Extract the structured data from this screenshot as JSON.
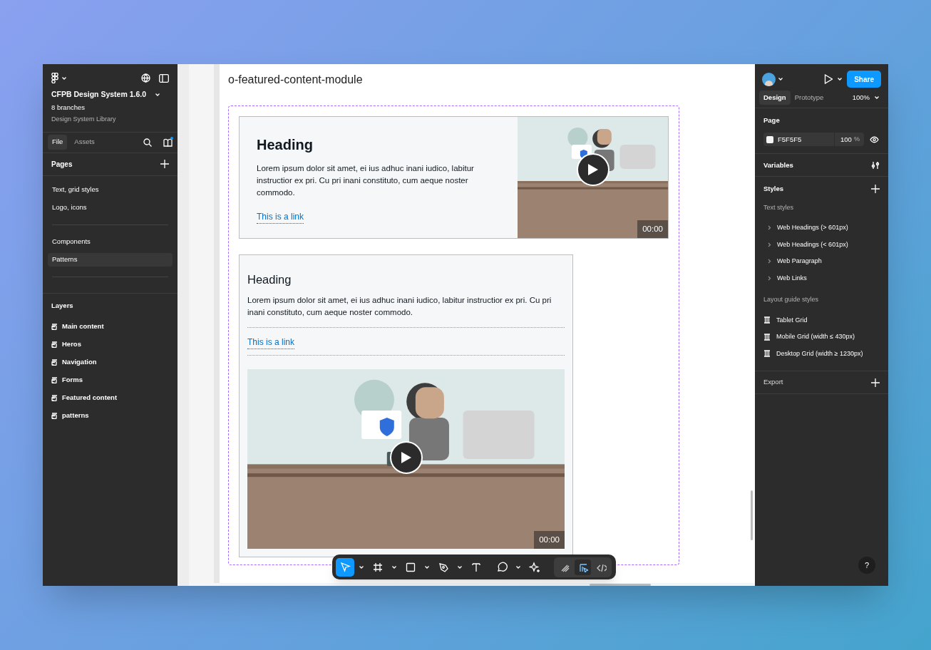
{
  "left_panel": {
    "file_name": "CFPB Design System 1.6.0",
    "branches": "8 branches",
    "team": "Design System Library",
    "tabs": [
      {
        "label": "File",
        "selected": true
      },
      {
        "label": "Assets",
        "selected": false
      }
    ],
    "pages_title": "Pages",
    "pages": [
      {
        "label": "Text, grid styles",
        "selected": false,
        "divider_after": false
      },
      {
        "label": "Logo, icons",
        "selected": false,
        "divider_after": true
      },
      {
        "label": "Components",
        "selected": false,
        "divider_after": false
      },
      {
        "label": "Patterns",
        "selected": true,
        "divider_after": true
      }
    ],
    "layers_title": "Layers",
    "layers": [
      "Main content",
      "Heros",
      "Navigation",
      "Forms",
      "Featured content",
      "patterns"
    ]
  },
  "canvas": {
    "frame_title": "o-featured-content-module",
    "modules": [
      {
        "kind": "wide",
        "heading": "Heading",
        "body": "Lorem ipsum dolor sit amet, ei ius adhuc inani iudico, labitur instructior ex pri. Cu pri inani constituto, cum aeque noster commodo.",
        "link": "This is a link",
        "duration": "00:00"
      },
      {
        "kind": "stacked",
        "heading": "Heading",
        "body": "Lorem ipsum dolor sit amet, ei ius adhuc inani iudico, labitur instructior ex pri. Cu pri inani constituto, cum aeque noster commodo.",
        "link": "This is a link",
        "duration": "00:00"
      }
    ],
    "toolbar": [
      {
        "kind": "move",
        "selected": true,
        "menu": true
      },
      {
        "kind": "frame",
        "selected": false,
        "menu": true
      },
      {
        "kind": "rectangle",
        "selected": false,
        "menu": true
      },
      {
        "kind": "pen",
        "selected": false,
        "menu": true
      },
      {
        "kind": "text",
        "selected": false,
        "menu": false
      },
      {
        "kind": "comment",
        "selected": false,
        "menu": true
      },
      {
        "kind": "ai",
        "selected": false,
        "menu": false
      }
    ],
    "modes": [
      {
        "kind": "draw",
        "selected": false
      },
      {
        "kind": "design",
        "selected": true
      },
      {
        "kind": "dev",
        "selected": false
      }
    ]
  },
  "right_panel": {
    "share": "Share",
    "tabs": [
      {
        "label": "Design",
        "selected": true
      },
      {
        "label": "Prototype",
        "selected": false
      }
    ],
    "zoom": "100%",
    "page_title": "Page",
    "page_color": "F5F5F5",
    "page_opacity": "100",
    "percent": "%",
    "variables_title": "Variables",
    "styles_title": "Styles",
    "text_styles_title": "Text styles",
    "text_styles": [
      "Web Headings (> 601px)",
      "Web Headings (< 601px)",
      "Web Paragraph",
      "Web Links"
    ],
    "layout_title": "Layout guide styles",
    "layout_styles": [
      "Tablet Grid",
      "Mobile Grid (width ≤ 430px)",
      "Desktop Grid (width ≥ 1230px)"
    ],
    "export_title": "Export",
    "help": "?"
  }
}
